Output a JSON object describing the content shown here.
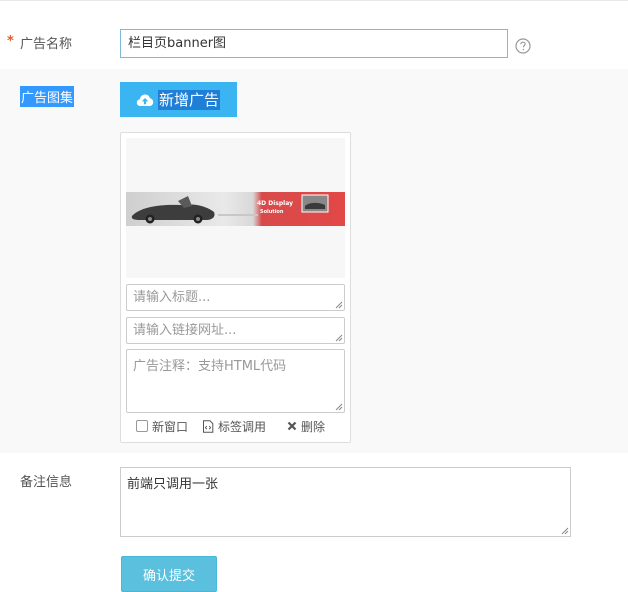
{
  "form": {
    "ad_name": {
      "label": "广告名称",
      "required_mark": "*",
      "value": "栏目页banner图"
    },
    "gallery": {
      "label": "广告图集",
      "add_button_label": "新增广告",
      "card": {
        "title_placeholder": "请输入标题...",
        "link_placeholder": "请输入链接网址...",
        "note_placeholder": "广告注释：支持HTML代码",
        "banner_text": "4D Display Solution",
        "new_window_label": "新窗口",
        "tag_call_label": "标签调用",
        "delete_label": "删除"
      }
    },
    "remark": {
      "label": "备注信息",
      "value": "前端只调用一张"
    },
    "submit_label": "确认提交"
  },
  "colors": {
    "accent": "#3bb4f2",
    "submit": "#5bc0de",
    "required": "#e05a29",
    "highlight": "#3399ff"
  }
}
